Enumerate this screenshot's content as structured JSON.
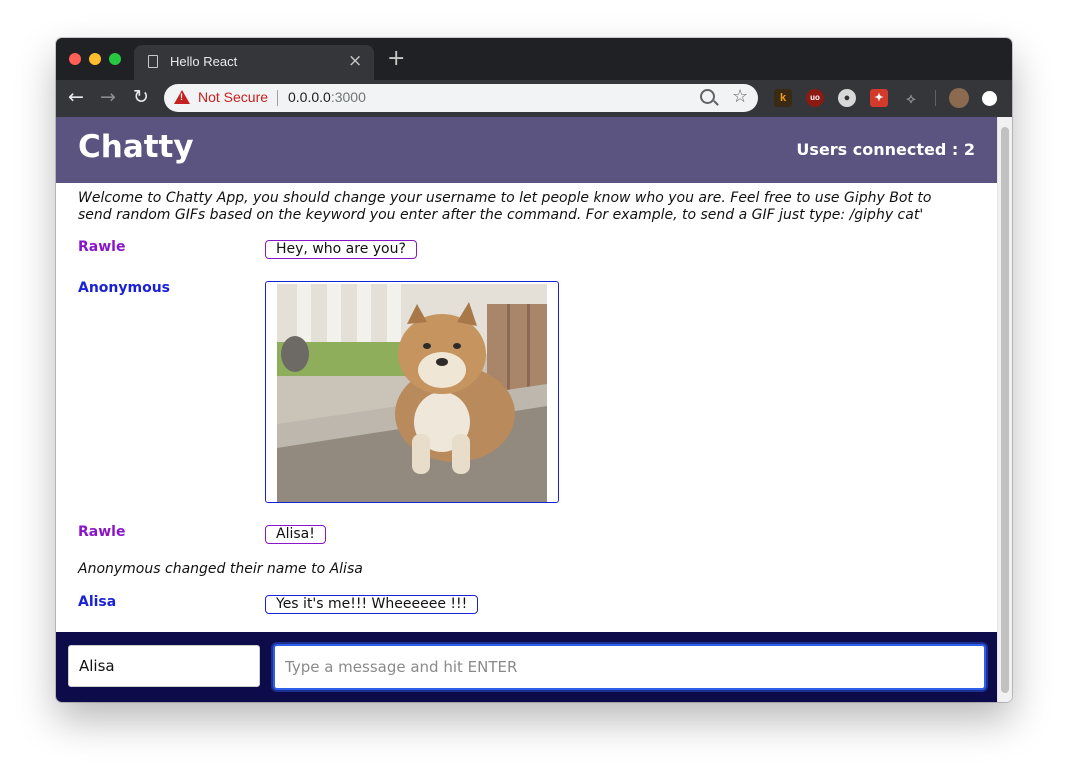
{
  "browser": {
    "tab_title": "Hello React",
    "tab_close": "×",
    "new_tab": "+",
    "back_glyph": "←",
    "forward_glyph": "→",
    "reload_glyph": "↻",
    "security_label": "Not Secure",
    "url_host": "0.0.0.0",
    "url_port": ":3000",
    "star_glyph": "☆",
    "extensions": [
      "k",
      "uo",
      "●",
      "✦",
      "⟡"
    ],
    "icons": [
      "page-icon",
      "back-arrow-icon",
      "forward-arrow-icon",
      "reload-icon",
      "warning-icon",
      "zoom-icon",
      "star-icon",
      "profile-avatar"
    ]
  },
  "app": {
    "brand": "Chatty",
    "users_connected": "Users connected : 2"
  },
  "welcome": "Welcome to Chatty App, you should change your username to let people know who you are. Feel free to use Giphy Bot to send random GIFs based on the keyword you enter after the command. For example, to send a GIF just type: /giphy cat'",
  "messages": [
    {
      "username": "Rawle",
      "content": "Hey, who are you?",
      "color": "#8a17c7"
    },
    {
      "username": "Anonymous",
      "content_type": "gif",
      "color": "#1a22d8"
    },
    {
      "username": "Rawle",
      "content": "Alisa!",
      "color": "#8a17c7"
    },
    {
      "system": "Anonymous changed their name to Alisa"
    },
    {
      "username": "Alisa",
      "content": "Yes it's me!!! Wheeeeee !!!",
      "color": "#1a22d8"
    }
  ],
  "compose": {
    "username_value": "Alisa",
    "message_placeholder": "Type a message and hit ENTER"
  },
  "colors": {
    "navbar": "#5b5480",
    "compose_bar": "#0e0b4b",
    "purple_user": "#8a17c7",
    "blue_user": "#1a22d8"
  }
}
